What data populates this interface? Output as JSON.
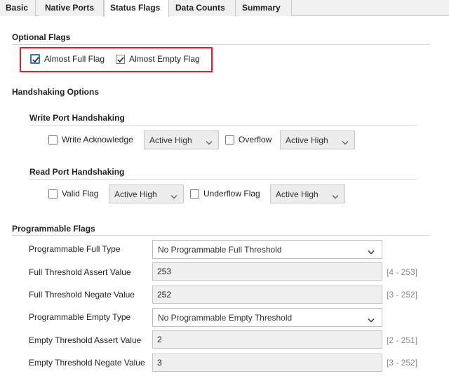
{
  "tabs": [
    {
      "label": "Basic"
    },
    {
      "label": "Native Ports"
    },
    {
      "label": "Status Flags"
    },
    {
      "label": "Data Counts"
    },
    {
      "label": "Summary"
    }
  ],
  "optional_flags": {
    "title": "Optional Flags",
    "almost_full": {
      "label": "Almost Full Flag",
      "checked": true
    },
    "almost_empty": {
      "label": "Almost Empty Flag",
      "checked": true
    }
  },
  "handshaking": {
    "title": "Handshaking Options",
    "write": {
      "title": "Write Port Handshaking",
      "write_ack": {
        "label": "Write Acknowledge",
        "checked": false,
        "level": "Active High"
      },
      "overflow": {
        "label": "Overflow",
        "checked": false,
        "level": "Active High"
      }
    },
    "read": {
      "title": "Read Port Handshaking",
      "valid": {
        "label": "Valid Flag",
        "checked": false,
        "level": "Active High"
      },
      "underflow": {
        "label": "Underflow Flag",
        "checked": false,
        "level": "Active High"
      }
    }
  },
  "programmable": {
    "title": "Programmable Flags",
    "full_type": {
      "label": "Programmable Full Type",
      "value": "No Programmable Full Threshold"
    },
    "full_assert": {
      "label": "Full Threshold Assert Value",
      "value": "253",
      "range": "[4 - 253]"
    },
    "full_negate": {
      "label": "Full Threshold Negate Value",
      "value": "252",
      "range": "[3 - 252]"
    },
    "empty_type": {
      "label": "Programmable Empty Type",
      "value": "No Programmable Empty Threshold"
    },
    "empty_assert": {
      "label": "Empty Threshold Assert Value",
      "value": "2",
      "range": "[2 - 251]"
    },
    "empty_negate": {
      "label": "Empty Threshold Negate Value",
      "value": "3",
      "range": "[3 - 252]"
    }
  }
}
